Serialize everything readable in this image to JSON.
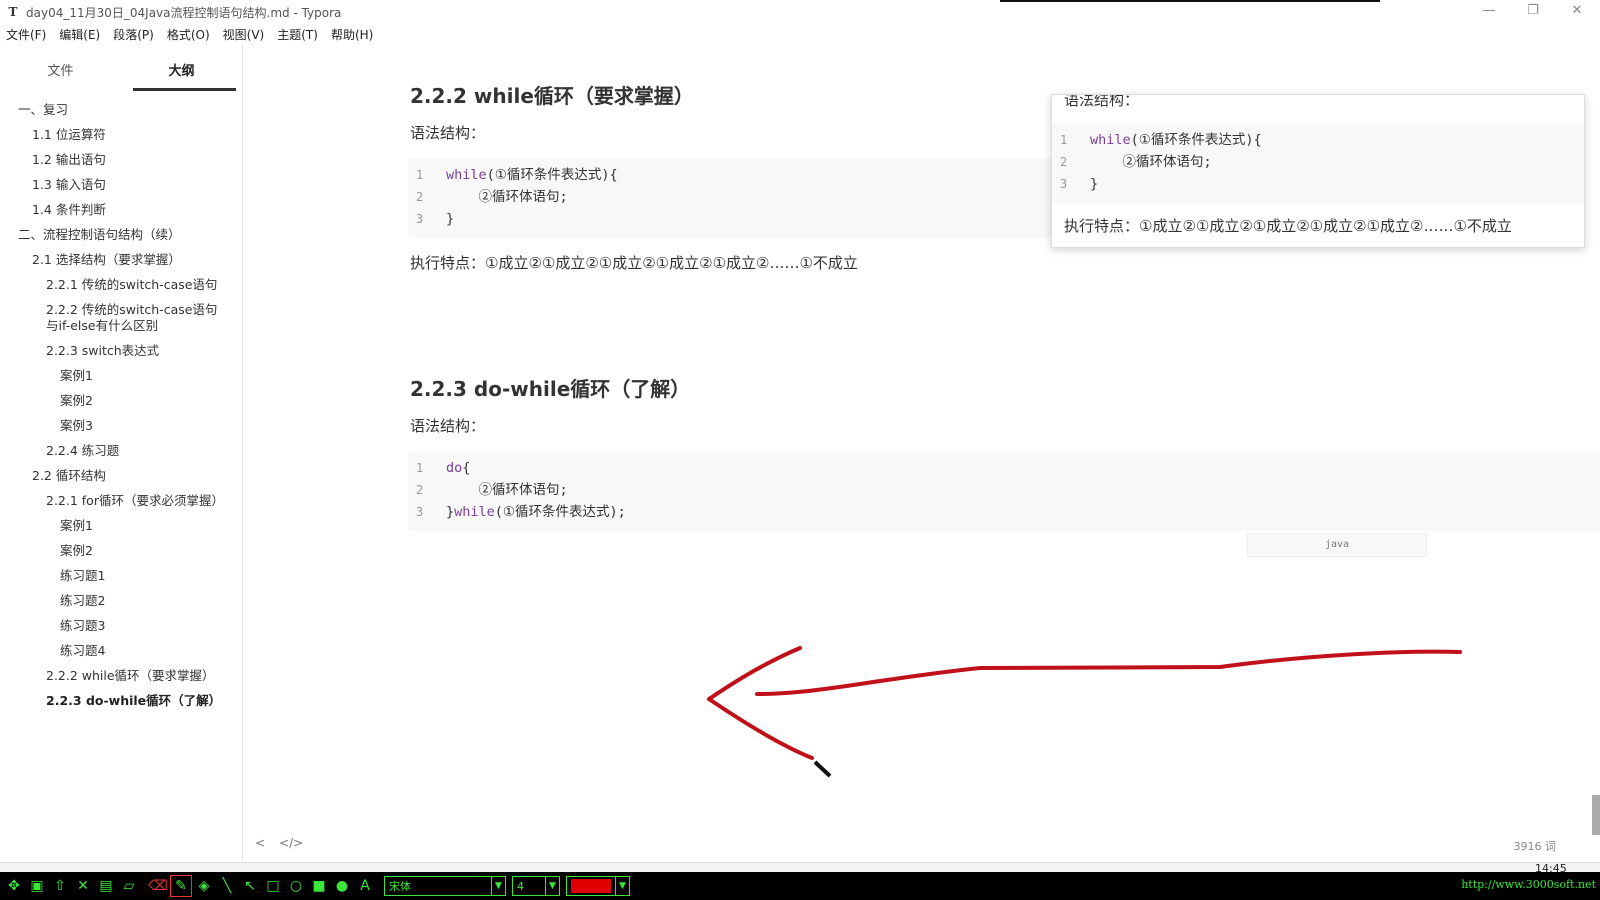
{
  "window": {
    "title": "day04_11月30日_04Java流程控制语句结构.md - Typora",
    "app_icon": "T",
    "controls": {
      "minimize": "—",
      "restore": "❐",
      "close": "✕"
    }
  },
  "menu": [
    {
      "label": "文件(F)"
    },
    {
      "label": "编辑(E)"
    },
    {
      "label": "段落(P)"
    },
    {
      "label": "格式(O)"
    },
    {
      "label": "视图(V)"
    },
    {
      "label": "主题(T)"
    },
    {
      "label": "帮助(H)"
    }
  ],
  "sidebar": {
    "tabs": [
      {
        "label": "文件",
        "active": false
      },
      {
        "label": "大纲",
        "active": true
      }
    ],
    "outline": [
      {
        "label": "一、复习",
        "level": 1
      },
      {
        "label": "1.1 位运算符",
        "level": 2
      },
      {
        "label": "1.2 输出语句",
        "level": 2
      },
      {
        "label": "1.3 输入语句",
        "level": 2
      },
      {
        "label": "1.4 条件判断",
        "level": 2
      },
      {
        "label": "二、流程控制语句结构（续）",
        "level": 1
      },
      {
        "label": "2.1 选择结构（要求掌握）",
        "level": 2
      },
      {
        "label": "2.2.1 传统的switch-case语句",
        "level": 3
      },
      {
        "label": "2.2.2 传统的switch-case语句与if-else有什么区别",
        "level": 3
      },
      {
        "label": "2.2.3 switch表达式",
        "level": 3
      },
      {
        "label": "案例1",
        "level": 4
      },
      {
        "label": "案例2",
        "level": 4
      },
      {
        "label": "案例3",
        "level": 4
      },
      {
        "label": "2.2.4 练习题",
        "level": 3
      },
      {
        "label": "2.2 循环结构",
        "level": 2
      },
      {
        "label": "2.2.1 for循环（要求必须掌握）",
        "level": 3
      },
      {
        "label": "案例1",
        "level": 4
      },
      {
        "label": "案例2",
        "level": 4
      },
      {
        "label": "练习题1",
        "level": 4
      },
      {
        "label": "练习题2",
        "level": 4
      },
      {
        "label": "练习题3",
        "level": 4
      },
      {
        "label": "练习题4",
        "level": 4
      },
      {
        "label": "2.2.2 while循环（要求掌握）",
        "level": 3
      },
      {
        "label": "2.2.3 do-while循环（了解）",
        "level": 3,
        "current": true
      }
    ]
  },
  "editor": {
    "while_heading": "2.2.2 while循环（要求掌握）",
    "while_syntax_label": "语法结构：",
    "while_code": [
      {
        "n": "1",
        "kw": "while",
        "rest": "(①循环条件表达式){"
      },
      {
        "n": "2",
        "kw": "",
        "rest": "    ②循环体语句;"
      },
      {
        "n": "3",
        "kw": "",
        "rest": "}"
      }
    ],
    "while_feature": "执行特点：①成立②①成立②①成立②①成立②①成立②……①不成立",
    "dowhile_heading": "2.2.3 do-while循环（了解）",
    "dowhile_syntax_label": "语法结构：",
    "dowhile_code": [
      {
        "n": "1",
        "kw": "do",
        "rest": "{"
      },
      {
        "n": "2",
        "kw": "",
        "rest": "    ②循环体语句;"
      },
      {
        "n": "3",
        "pre": "}",
        "kw": "while",
        "rest": "(①循环条件表达式);"
      }
    ],
    "code_lang": "java"
  },
  "popup": {
    "syntax_label": "语法结构：",
    "code": [
      {
        "n": "1",
        "kw": "while",
        "rest": "(①循环条件表达式){"
      },
      {
        "n": "2",
        "kw": "",
        "rest": "    ②循环体语句;"
      },
      {
        "n": "3",
        "kw": "",
        "rest": "}"
      }
    ],
    "feature": "执行特点：①成立②①成立②①成立②①成立②①成立②……①不成立"
  },
  "footer": {
    "back_icon": "<",
    "source_icon": "</>",
    "word_count": "3916 词"
  },
  "toolbar": {
    "font_name": "宋体",
    "size_value": "4",
    "pen_color": "#e00000",
    "url": "http://www.3000soft.net",
    "clock": "14:45"
  },
  "colors": {
    "annotation_stroke": "#c0101a",
    "toolbar_green": "#39e639"
  }
}
